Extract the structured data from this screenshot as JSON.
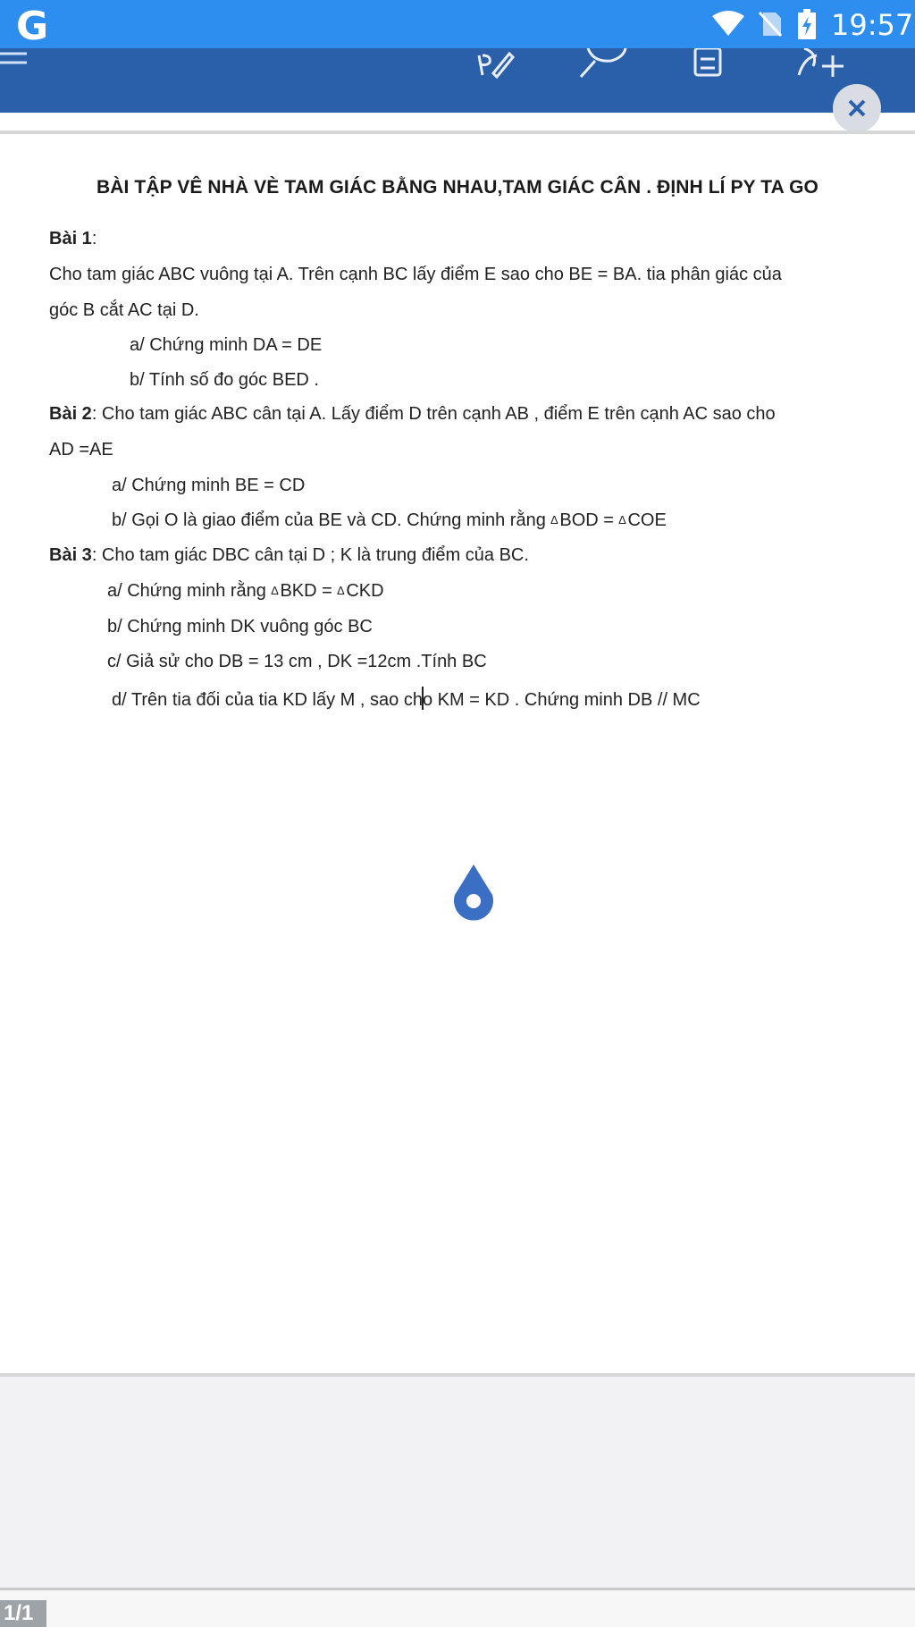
{
  "status_bar": {
    "app_logo": "G",
    "time": "19:57",
    "icons": [
      "wifi-icon",
      "no-sim-icon",
      "battery-charging-icon"
    ]
  },
  "toolbar": {
    "icons": [
      "menu-icon",
      "edit-pen-icon",
      "search-icon",
      "document-icon",
      "add-person-icon",
      "close-icon"
    ]
  },
  "document": {
    "title": "BÀI TẬP VÊ NHÀ VÈ TAM GIÁC BẰNG NHAU,TAM GIÁC CÂN . ĐỊNH LÍ PY TA GO",
    "bai1": {
      "heading": "Bài 1",
      "colon": ":",
      "text1": "Cho tam giác ABC vuông tại A. Trên cạnh BC lấy điểm E sao cho BE = BA. tia phân giác của",
      "text2": "góc B cắt AC  tại D.",
      "a": "a/    Chứng minh DA = DE",
      "b": "b/  Tính số đo góc BED  ."
    },
    "bai2": {
      "heading": "Bài 2",
      "text1": ": Cho tam giác ABC cân tại A. Lấy điểm D trên cạnh AB , điểm E trên cạnh AC sao cho",
      "text2": "AD =AE",
      "a": "a/    Chứng minh BE = CD",
      "b_prefix": "b/ Gọi  O là giao điểm  của BE và CD. Chứng minh rằng",
      "b_tri1": "BOD = ",
      "b_tri2": "COE"
    },
    "bai3": {
      "heading": "Bài 3",
      "text1": ":  Cho tam giác DBC cân tại  D ; K là trung điểm của BC.",
      "a_prefix": "a/ Chứng minh rằng",
      "a_tri1": "BKD = ",
      "a_tri2": "CKD",
      "b": "b/ Chứng minh DK vuông góc BC",
      "c": "c/ Giả sử cho DB = 13 cm , DK =12cm .Tính BC",
      "d_before": "d/ Trên tia đối của tia KD  lấy M , sao ch",
      "d_after": "o KM = KD . Chứng minh DB // MC"
    },
    "triangle_symbol": "∆"
  },
  "footer": {
    "page_indicator": "1/1"
  },
  "colors": {
    "status_bar": "#2d8ef0",
    "toolbar": "#2a5faa",
    "selection_handle": "#3b6fc4"
  }
}
